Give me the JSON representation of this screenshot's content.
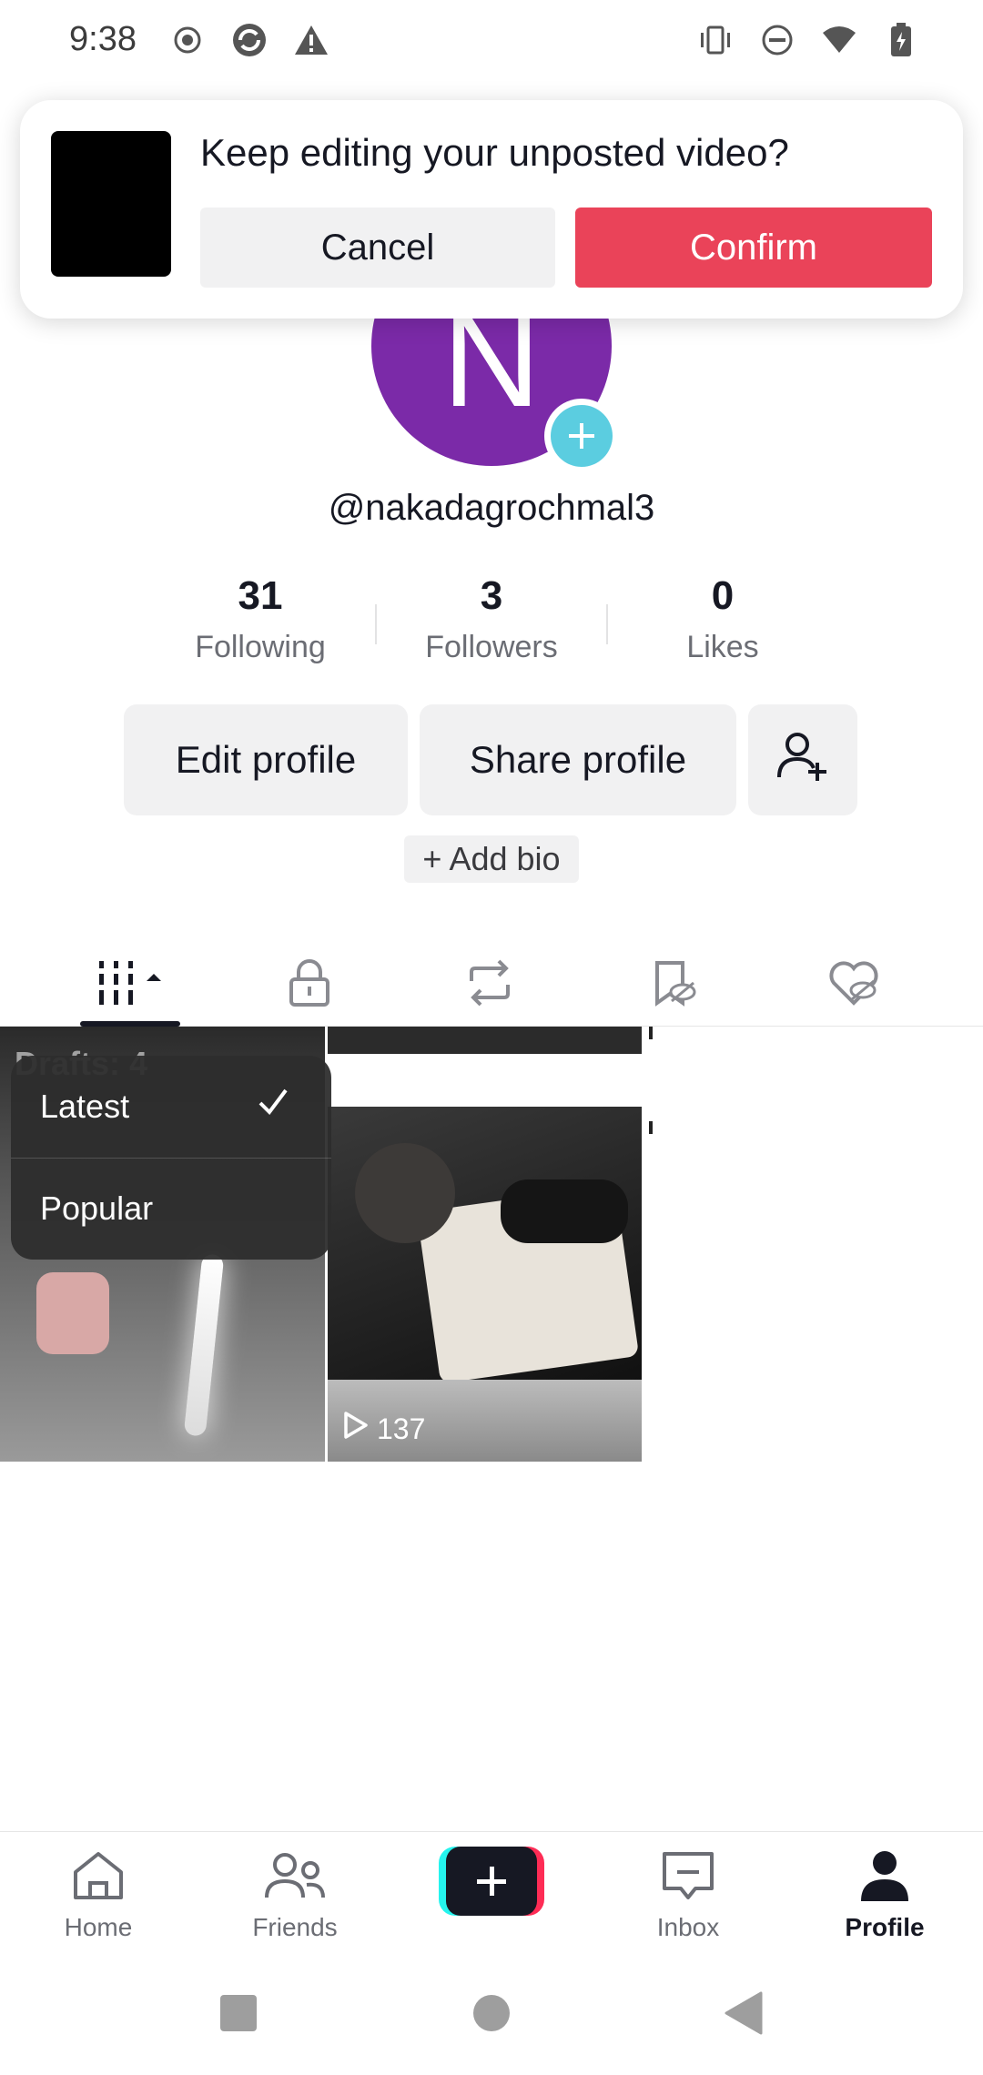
{
  "status_bar": {
    "time": "9:38"
  },
  "draft_prompt": {
    "title": "Keep editing your unposted video?",
    "cancel": "Cancel",
    "confirm": "Confirm"
  },
  "profile": {
    "avatar_letter": "N",
    "username": "@nakadagrochmal3",
    "stats": [
      {
        "value": "31",
        "label": "Following"
      },
      {
        "value": "3",
        "label": "Followers"
      },
      {
        "value": "0",
        "label": "Likes"
      }
    ],
    "edit_profile": "Edit profile",
    "share_profile": "Share profile",
    "add_bio": "+ Add bio"
  },
  "grid": {
    "drafts_label": "Drafts: 4",
    "video_views": "137"
  },
  "sort_menu": {
    "options": [
      "Latest",
      "Popular"
    ],
    "selected": "Latest"
  },
  "bottom_nav": {
    "home": "Home",
    "friends": "Friends",
    "inbox": "Inbox",
    "profile": "Profile"
  }
}
